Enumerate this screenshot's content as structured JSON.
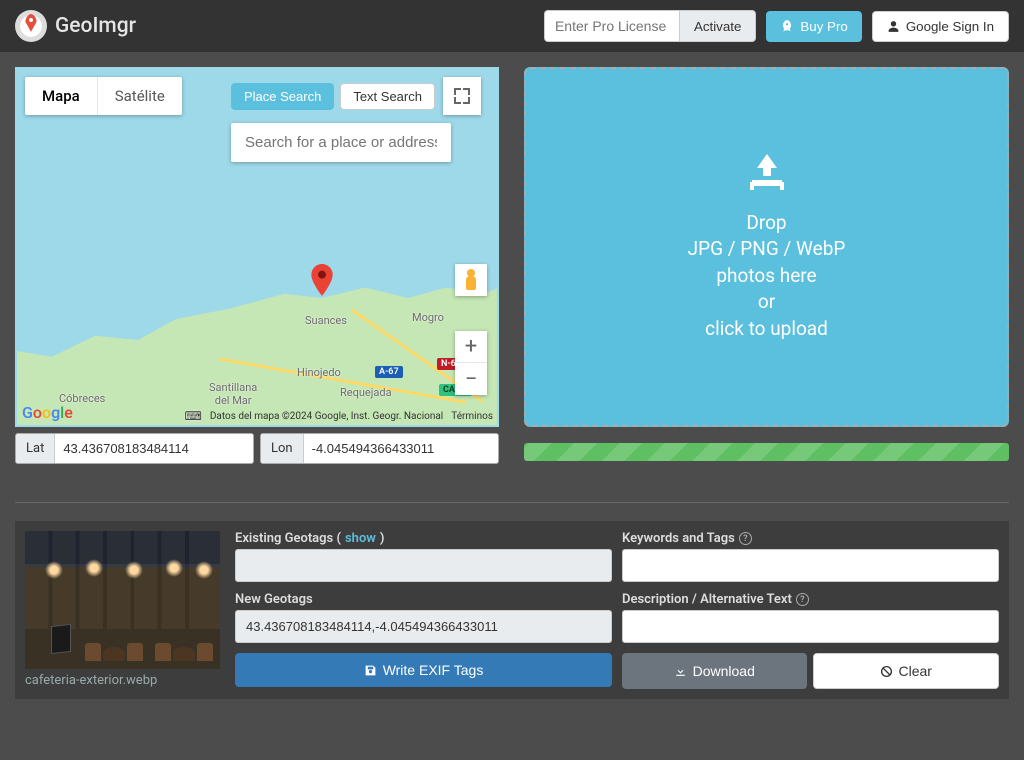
{
  "brand": "GeoImgr",
  "header": {
    "license_placeholder": "Enter Pro License",
    "activate": "Activate",
    "buy_pro": "Buy Pro",
    "sign_in": "Google Sign In"
  },
  "map": {
    "tabs": {
      "map": "Mapa",
      "satellite": "Satélite"
    },
    "search": {
      "place_search": "Place Search",
      "text_search": "Text Search",
      "placeholder": "Search for a place or address"
    },
    "labels": {
      "suances": "Suances",
      "mogro": "Mogro",
      "hinojedo": "Hinojedo",
      "requejada": "Requejada",
      "santillana": "Santillana\ndel Mar",
      "cobreces": "Cóbreces"
    },
    "shields": {
      "a67": "A-67",
      "n6": "N-6",
      "ca23": "CA-23"
    },
    "zoom": {
      "in": "+",
      "out": "−"
    },
    "attribution": "Datos del mapa ©2024 Google, Inst. Geogr. Nacional",
    "terms": "Términos"
  },
  "coords": {
    "lat_label": "Lat",
    "lat_value": "43.436708183484114",
    "lon_label": "Lon",
    "lon_value": "-4.045494366433011"
  },
  "dropzone": {
    "l1": "Drop",
    "l2": "JPG / PNG / WebP",
    "l3": "photos here",
    "l4": "or",
    "l5": "click to upload"
  },
  "bottom": {
    "thumbnail_name": "cafeteria-exterior.webp",
    "existing_label_pre": "Existing Geotags (",
    "existing_show": "show",
    "existing_label_post": ")",
    "existing_value": "",
    "new_label": "New Geotags",
    "new_value": "43.436708183484114,-4.045494366433011",
    "keywords_label": "Keywords and Tags",
    "keywords_value": "",
    "desc_label": "Description / Alternative Text",
    "desc_value": "",
    "write": "Write EXIF Tags",
    "download": "Download",
    "clear": "Clear"
  }
}
